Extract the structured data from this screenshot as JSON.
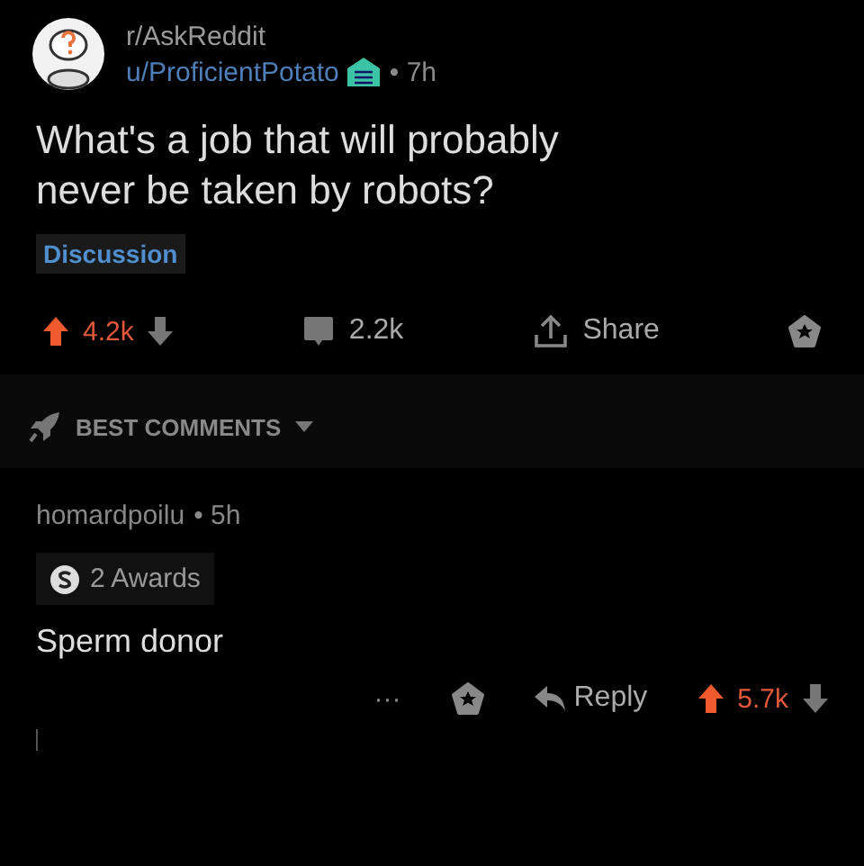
{
  "post": {
    "subreddit": "r/AskReddit",
    "author": "u/ProficientPotato",
    "time": "• 7h",
    "title": "What's a job that will probably never be taken by robots?",
    "flair": "Discussion",
    "score": "4.2k",
    "upvoted": true,
    "comments": "2.2k",
    "share": "Share"
  },
  "sort": {
    "label": "BEST COMMENTS"
  },
  "comments": [
    {
      "author": "homardpoilu",
      "time": "• 5h",
      "awards": "2 Awards",
      "body": "Sperm donor",
      "more": "···",
      "reply": "Reply",
      "score": "5.7k",
      "upvoted": true
    }
  ]
}
